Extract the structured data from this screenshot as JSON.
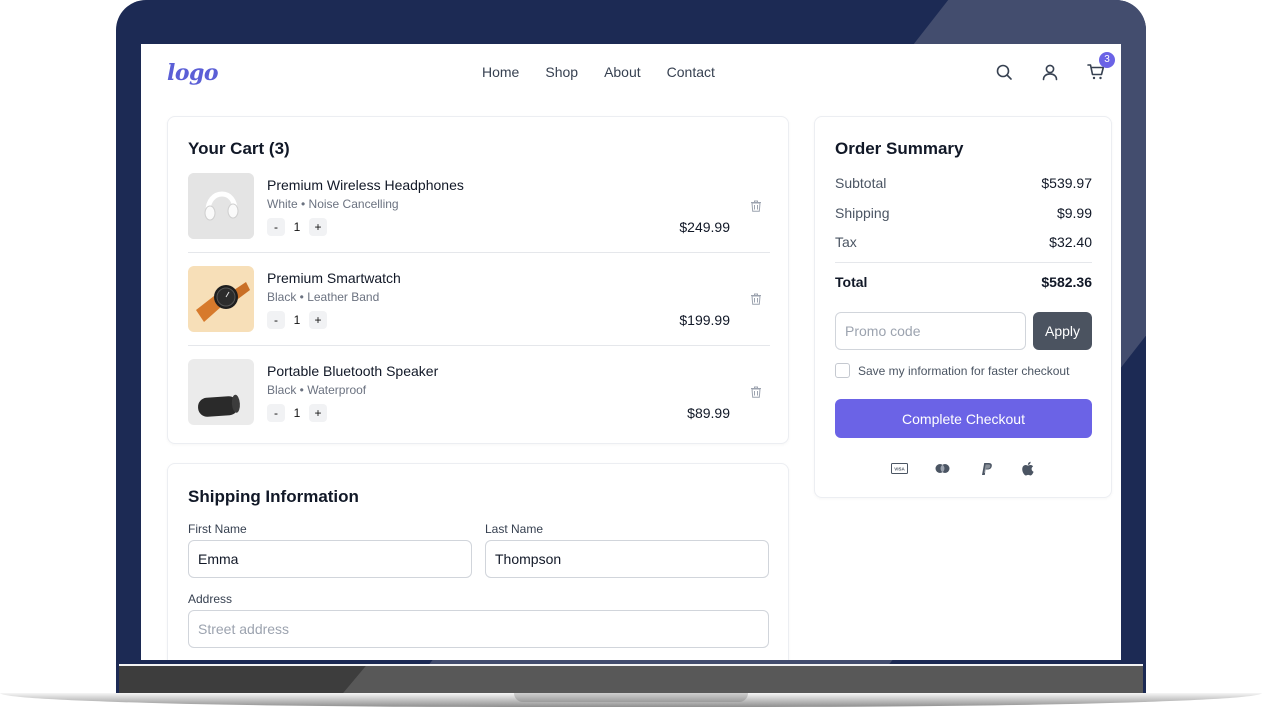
{
  "header": {
    "logo": "logo",
    "nav": [
      "Home",
      "Shop",
      "About",
      "Contact"
    ],
    "cart_count": "3",
    "icons": [
      "search-icon",
      "user-icon",
      "cart-icon"
    ]
  },
  "cart": {
    "title": "Your Cart (3)",
    "items": [
      {
        "name": "Premium Wireless Headphones",
        "variant": "White • Noise Cancelling",
        "qty": "1",
        "price": "$249.99",
        "minus": "-",
        "plus": "+"
      },
      {
        "name": "Premium Smartwatch",
        "variant": "Black • Leather Band",
        "qty": "1",
        "price": "$199.99",
        "minus": "-",
        "plus": "+"
      },
      {
        "name": "Portable Bluetooth Speaker",
        "variant": "Black • Waterproof",
        "qty": "1",
        "price": "$89.99",
        "minus": "-",
        "plus": "+"
      }
    ]
  },
  "shipping": {
    "title": "Shipping Information",
    "first_name_label": "First Name",
    "first_name_value": "Emma",
    "last_name_label": "Last Name",
    "last_name_value": "Thompson",
    "address_label": "Address",
    "address_placeholder": "Street address"
  },
  "summary": {
    "title": "Order Summary",
    "subtotal_label": "Subtotal",
    "subtotal": "$539.97",
    "shipping_label": "Shipping",
    "shipping": "$9.99",
    "tax_label": "Tax",
    "tax": "$32.40",
    "total_label": "Total",
    "total": "$582.36",
    "promo_placeholder": "Promo code",
    "apply_label": "Apply",
    "save_info_label": "Save my information for faster checkout",
    "checkout_label": "Complete Checkout",
    "payment_icons": [
      "visa-icon",
      "mastercard-icon",
      "paypal-icon",
      "apple-pay-icon"
    ]
  },
  "colors": {
    "accent": "#6b63e6",
    "apply_button": "#4b5360",
    "frame": "#1c2a54"
  }
}
